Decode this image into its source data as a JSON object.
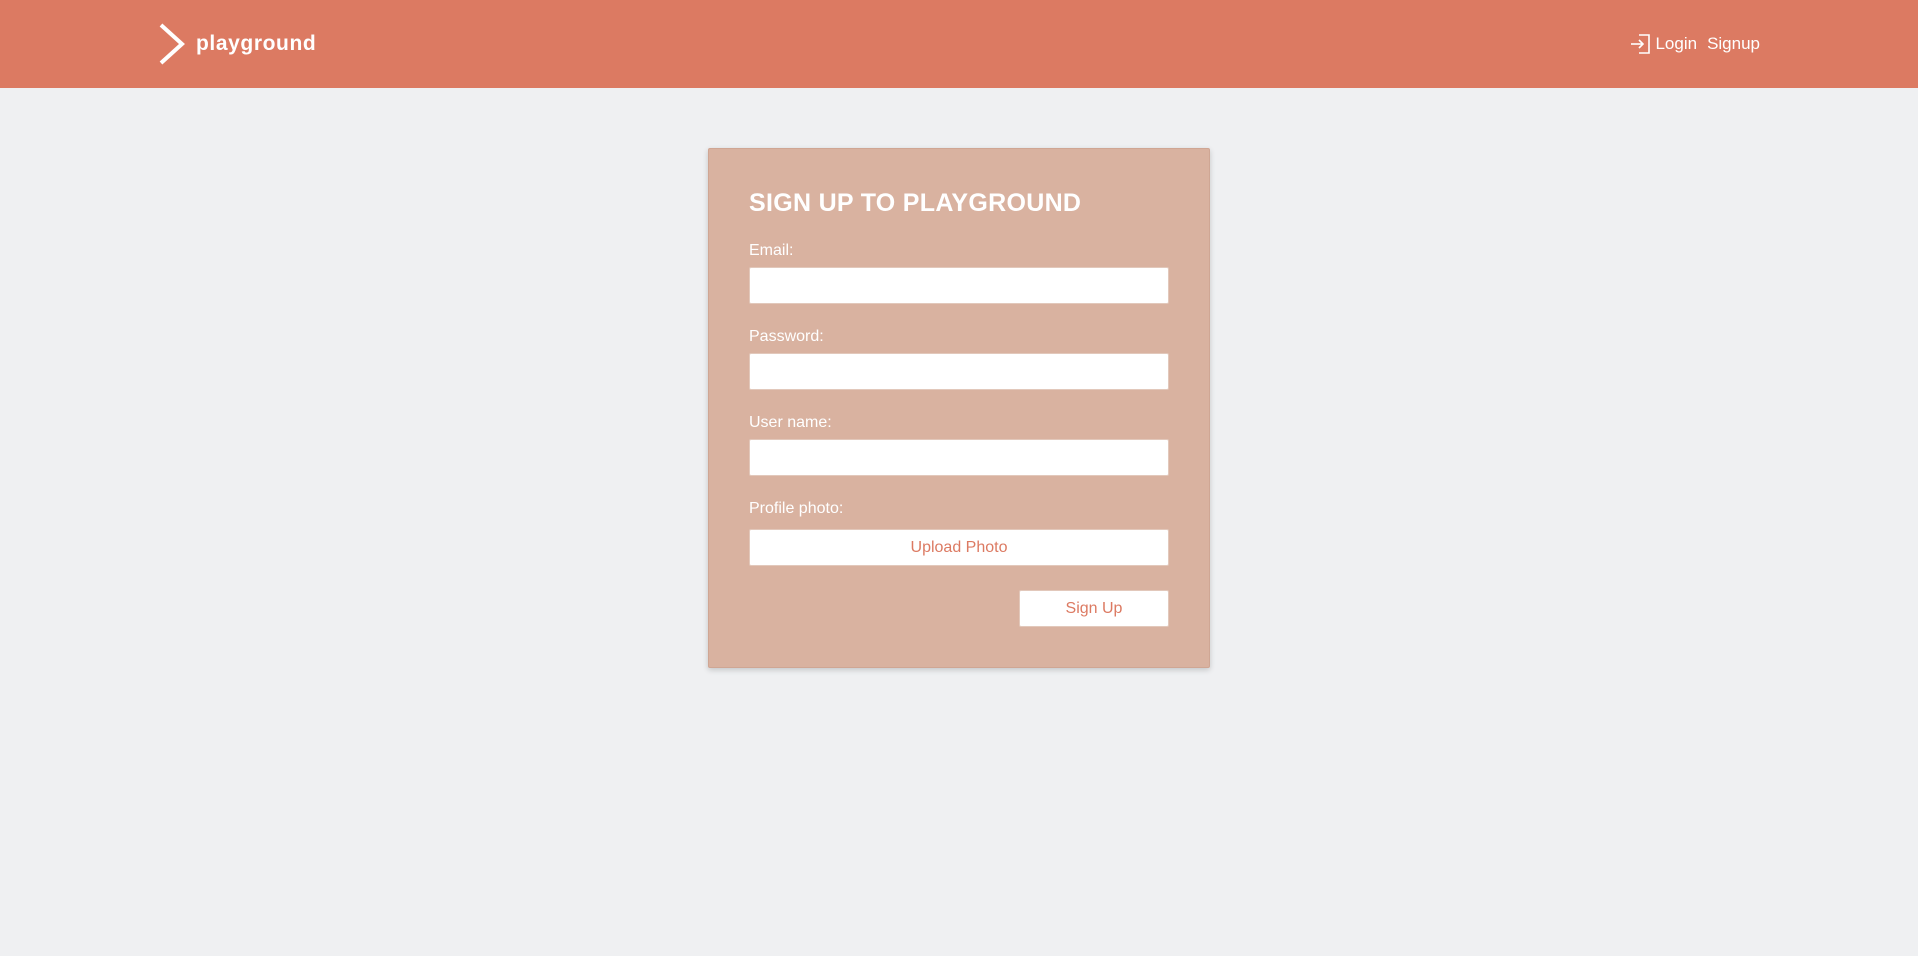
{
  "header": {
    "brand_name": "playground",
    "brand_icon": "chevron-right-icon",
    "nav": {
      "login_icon": "login-icon",
      "login_label": "Login",
      "signup_label": "Signup"
    }
  },
  "form": {
    "title": "SIGN UP TO PLAYGROUND",
    "email_label": "Email:",
    "email_value": "",
    "password_label": "Password:",
    "password_value": "",
    "username_label": "User name:",
    "username_value": "",
    "photo_label": "Profile photo:",
    "upload_label": "Upload Photo",
    "submit_label": "Sign Up"
  },
  "colors": {
    "header_bg": "#dc7a62",
    "page_bg": "#eff0f2",
    "card_bg": "#d9b2a0",
    "accent_text": "#dc7a62",
    "light_text": "#ffffff"
  }
}
